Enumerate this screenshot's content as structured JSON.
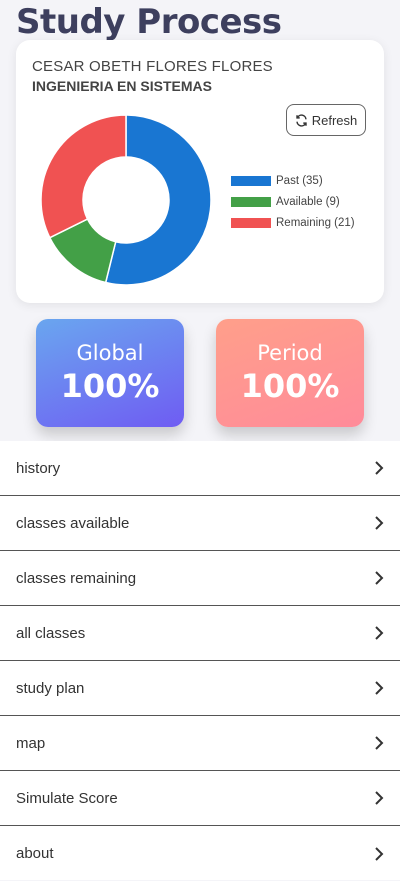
{
  "page": {
    "title": "Study Process"
  },
  "student": {
    "name": "CESAR OBETH FLORES FLORES",
    "career": "INGENIERIA EN SISTEMAS"
  },
  "refresh": {
    "label": "Refresh",
    "icon": "refresh-icon"
  },
  "chart_data": {
    "type": "pie",
    "categories": [
      "Past (35)",
      "Available (9)",
      "Remaining (21)"
    ],
    "values": [
      35,
      9,
      21
    ],
    "colors": [
      "#1976d2",
      "#43a047",
      "#f05252"
    ],
    "legend_position": "right"
  },
  "stats": {
    "global": {
      "label": "Global",
      "value": "100%"
    },
    "period": {
      "label": "Period",
      "value": "100%"
    }
  },
  "menu": {
    "items": [
      {
        "label": "history"
      },
      {
        "label": "classes available"
      },
      {
        "label": "classes remaining"
      },
      {
        "label": "all classes"
      },
      {
        "label": "study plan"
      },
      {
        "label": "map"
      },
      {
        "label": "Simulate Score"
      },
      {
        "label": "about"
      }
    ]
  }
}
